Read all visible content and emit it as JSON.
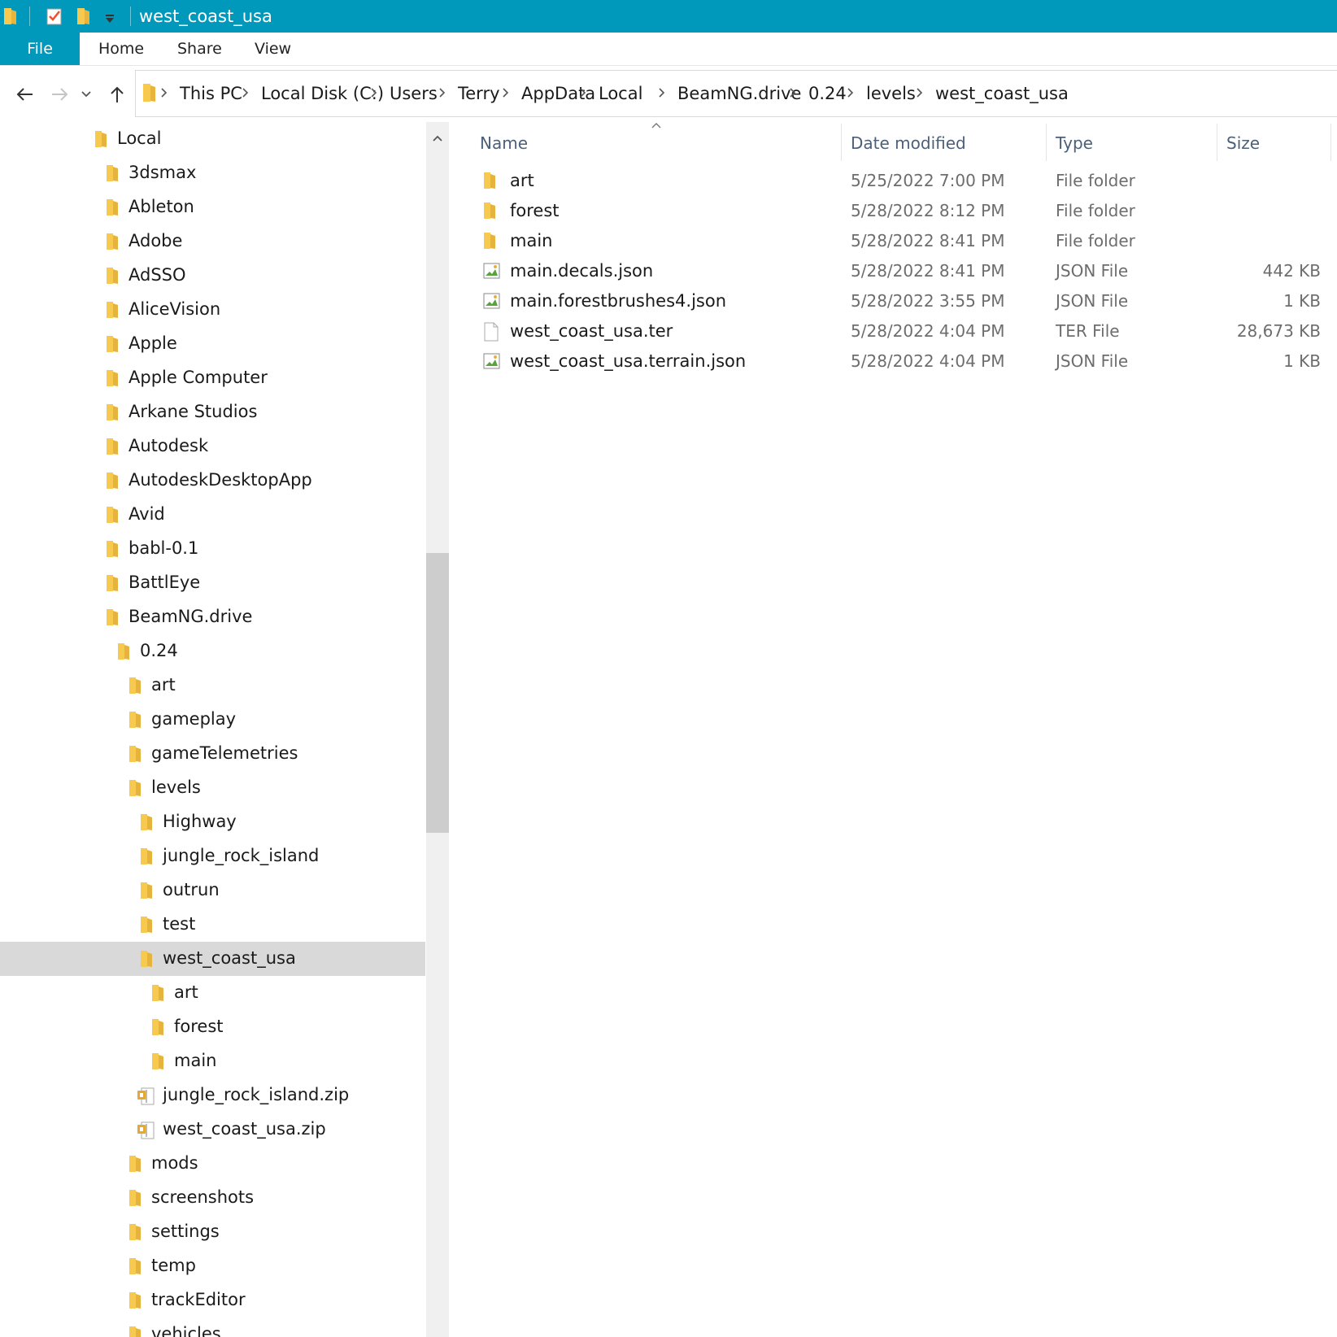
{
  "window": {
    "title": "west_coast_usa"
  },
  "ribbon": {
    "tabs": [
      "File",
      "Home",
      "Share",
      "View"
    ]
  },
  "address": {
    "breadcrumbs": [
      "This PC",
      "Local Disk (C:)",
      "Users",
      "Terry",
      "AppData",
      "Local",
      "BeamNG.drive",
      "0.24",
      "levels",
      "west_coast_usa"
    ]
  },
  "nav_tree": [
    {
      "label": "Local",
      "icon": "folder-icon",
      "level": 0
    },
    {
      "label": "3dsmax",
      "icon": "folder-icon",
      "level": 1
    },
    {
      "label": "Ableton",
      "icon": "folder-icon",
      "level": 1
    },
    {
      "label": "Adobe",
      "icon": "folder-icon",
      "level": 1
    },
    {
      "label": "AdSSO",
      "icon": "folder-icon",
      "level": 1
    },
    {
      "label": "AliceVision",
      "icon": "folder-icon",
      "level": 1
    },
    {
      "label": "Apple",
      "icon": "folder-icon",
      "level": 1
    },
    {
      "label": "Apple Computer",
      "icon": "folder-icon",
      "level": 1
    },
    {
      "label": "Arkane Studios",
      "icon": "folder-icon",
      "level": 1
    },
    {
      "label": "Autodesk",
      "icon": "folder-icon",
      "level": 1
    },
    {
      "label": "AutodeskDesktopApp",
      "icon": "folder-icon",
      "level": 1
    },
    {
      "label": "Avid",
      "icon": "folder-icon",
      "level": 1
    },
    {
      "label": "babl-0.1",
      "icon": "folder-icon",
      "level": 1
    },
    {
      "label": "BattlEye",
      "icon": "folder-icon",
      "level": 1
    },
    {
      "label": "BeamNG.drive",
      "icon": "folder-icon",
      "level": 1
    },
    {
      "label": "0.24",
      "icon": "folder-icon",
      "level": 2
    },
    {
      "label": "art",
      "icon": "folder-icon",
      "level": 3
    },
    {
      "label": "gameplay",
      "icon": "folder-icon",
      "level": 3
    },
    {
      "label": "gameTelemetries",
      "icon": "folder-icon",
      "level": 3
    },
    {
      "label": "levels",
      "icon": "folder-icon",
      "level": 3
    },
    {
      "label": "Highway",
      "icon": "folder-icon",
      "level": 4
    },
    {
      "label": "jungle_rock_island",
      "icon": "folder-icon",
      "level": 4
    },
    {
      "label": "outrun",
      "icon": "folder-icon",
      "level": 4
    },
    {
      "label": "test",
      "icon": "folder-icon",
      "level": 4
    },
    {
      "label": "west_coast_usa",
      "icon": "folder-icon",
      "level": 4,
      "selected": true
    },
    {
      "label": "art",
      "icon": "folder-icon",
      "level": 5
    },
    {
      "label": "forest",
      "icon": "folder-icon",
      "level": 5
    },
    {
      "label": "main",
      "icon": "folder-icon",
      "level": 5
    },
    {
      "label": "jungle_rock_island.zip",
      "icon": "zip-icon",
      "level": 4
    },
    {
      "label": "west_coast_usa.zip",
      "icon": "zip-icon",
      "level": 4
    },
    {
      "label": "mods",
      "icon": "folder-icon",
      "level": 3
    },
    {
      "label": "screenshots",
      "icon": "folder-icon",
      "level": 3
    },
    {
      "label": "settings",
      "icon": "folder-icon",
      "level": 3
    },
    {
      "label": "temp",
      "icon": "folder-icon",
      "level": 3
    },
    {
      "label": "trackEditor",
      "icon": "folder-icon",
      "level": 3
    },
    {
      "label": "vehicles",
      "icon": "folder-icon",
      "level": 3
    }
  ],
  "file_list": {
    "columns": {
      "name": "Name",
      "date": "Date modified",
      "type": "Type",
      "size": "Size"
    },
    "rows": [
      {
        "name": "art",
        "date": "5/25/2022 7:00 PM",
        "type": "File folder",
        "size": "",
        "icon": "folder-icon"
      },
      {
        "name": "forest",
        "date": "5/28/2022 8:12 PM",
        "type": "File folder",
        "size": "",
        "icon": "folder-icon"
      },
      {
        "name": "main",
        "date": "5/28/2022 8:41 PM",
        "type": "File folder",
        "size": "",
        "icon": "folder-icon"
      },
      {
        "name": "main.decals.json",
        "date": "5/28/2022 8:41 PM",
        "type": "JSON File",
        "size": "442 KB",
        "icon": "json-file-icon"
      },
      {
        "name": "main.forestbrushes4.json",
        "date": "5/28/2022 3:55 PM",
        "type": "JSON File",
        "size": "1 KB",
        "icon": "json-file-icon"
      },
      {
        "name": "west_coast_usa.ter",
        "date": "5/28/2022 4:04 PM",
        "type": "TER File",
        "size": "28,673 KB",
        "icon": "blank-file-icon"
      },
      {
        "name": "west_coast_usa.terrain.json",
        "date": "5/28/2022 4:04 PM",
        "type": "JSON File",
        "size": "1 KB",
        "icon": "json-file-icon"
      }
    ]
  },
  "colors": {
    "accent": "#0099bc",
    "selection": "#d9d9d9",
    "folder": "#f8c94f"
  }
}
